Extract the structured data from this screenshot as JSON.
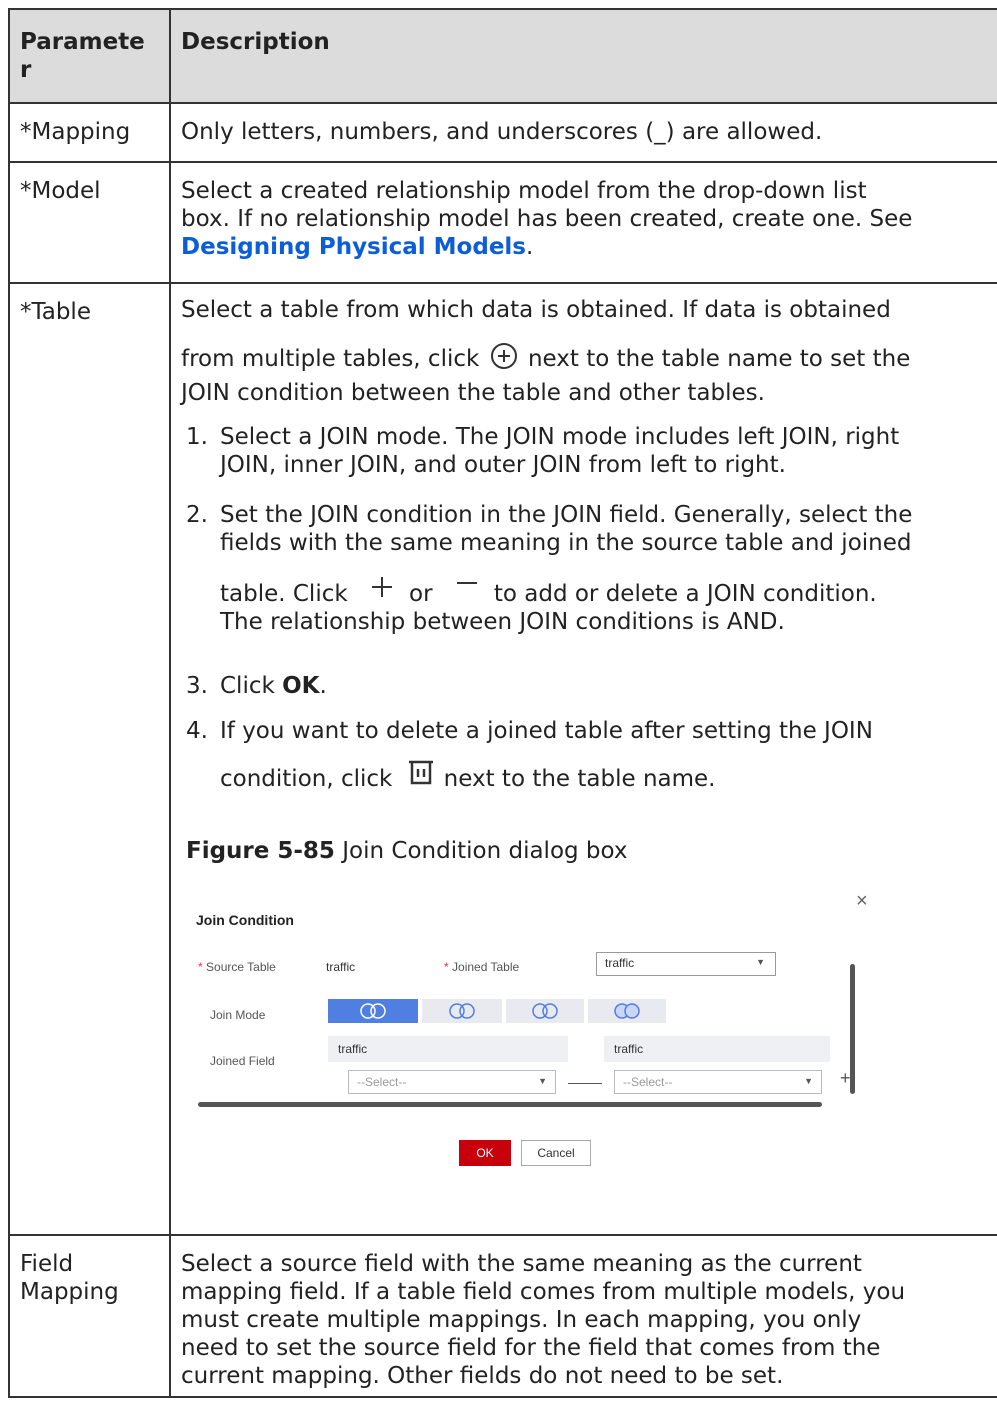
{
  "header": {
    "col1": "Paramete\nr",
    "col1_line1": "Paramete",
    "col1_line2": "r",
    "col2": "Description"
  },
  "rows": {
    "mapping": {
      "param": "*Mapping",
      "desc": "Only letters, numbers, and underscores (_) are allowed."
    },
    "model": {
      "param": "*Model",
      "desc_line1": "Select a created relationship model from the drop-down list",
      "desc_line2": "box. If no relationship model has been created, create one. See",
      "link": "Designing Physical Models",
      "after_link": "."
    },
    "table": {
      "param": "*Table",
      "line1": "Select a table from which data is obtained. If data is obtained",
      "line2a": "from multiple tables, click",
      "line2b": "next to the table name to set the",
      "line3": "JOIN condition between the table and other tables.",
      "steps": [
        {
          "num": "1.",
          "l1": "Select a JOIN mode. The JOIN mode includes left JOIN, right",
          "l2": "JOIN, inner JOIN, and outer JOIN from left to right."
        },
        {
          "num": "2.",
          "l1": "Set the JOIN condition in the JOIN field. Generally, select the",
          "l2": "fields with the same meaning in the source table and joined",
          "l3a": "table. Click",
          "l3b": "or",
          "l3c": "to add or delete a JOIN condition.",
          "l4": "The relationship between JOIN conditions is AND."
        },
        {
          "num": "3.",
          "l1a": "Click",
          "l1b": "OK",
          "l1c": "."
        },
        {
          "num": "4.",
          "l1": "If you want to delete a joined table after setting the JOIN",
          "l2a": "condition, click",
          "l2b": "next to the table name."
        }
      ],
      "figure_caption_bold": "Figure 5-85",
      "figure_caption_text": "Join Condition dialog box"
    },
    "field_mapping": {
      "param_l1": "Field",
      "param_l2": "Mapping",
      "lines": [
        "Select a source field with the same meaning as the current",
        "mapping field. If a table field comes from multiple models, you",
        "must create multiple mappings. In each mapping, you only",
        "need to set the source field for the field that comes from the",
        "current mapping. Other fields do not need to be set."
      ]
    }
  },
  "dialog": {
    "title": "Join Condition",
    "close": "×",
    "source_table_label": "Source Table",
    "source_table_value": "traffic",
    "joined_table_label": "Joined Table",
    "joined_table_value": "traffic",
    "join_mode_label": "Join Mode",
    "joined_field_label": "Joined Field",
    "left_header": "traffic",
    "right_header": "traffic",
    "select_placeholder": "--Select--",
    "ok": "OK",
    "cancel": "Cancel",
    "accent": "#4f7fe0",
    "ok_color": "#c7000b"
  }
}
